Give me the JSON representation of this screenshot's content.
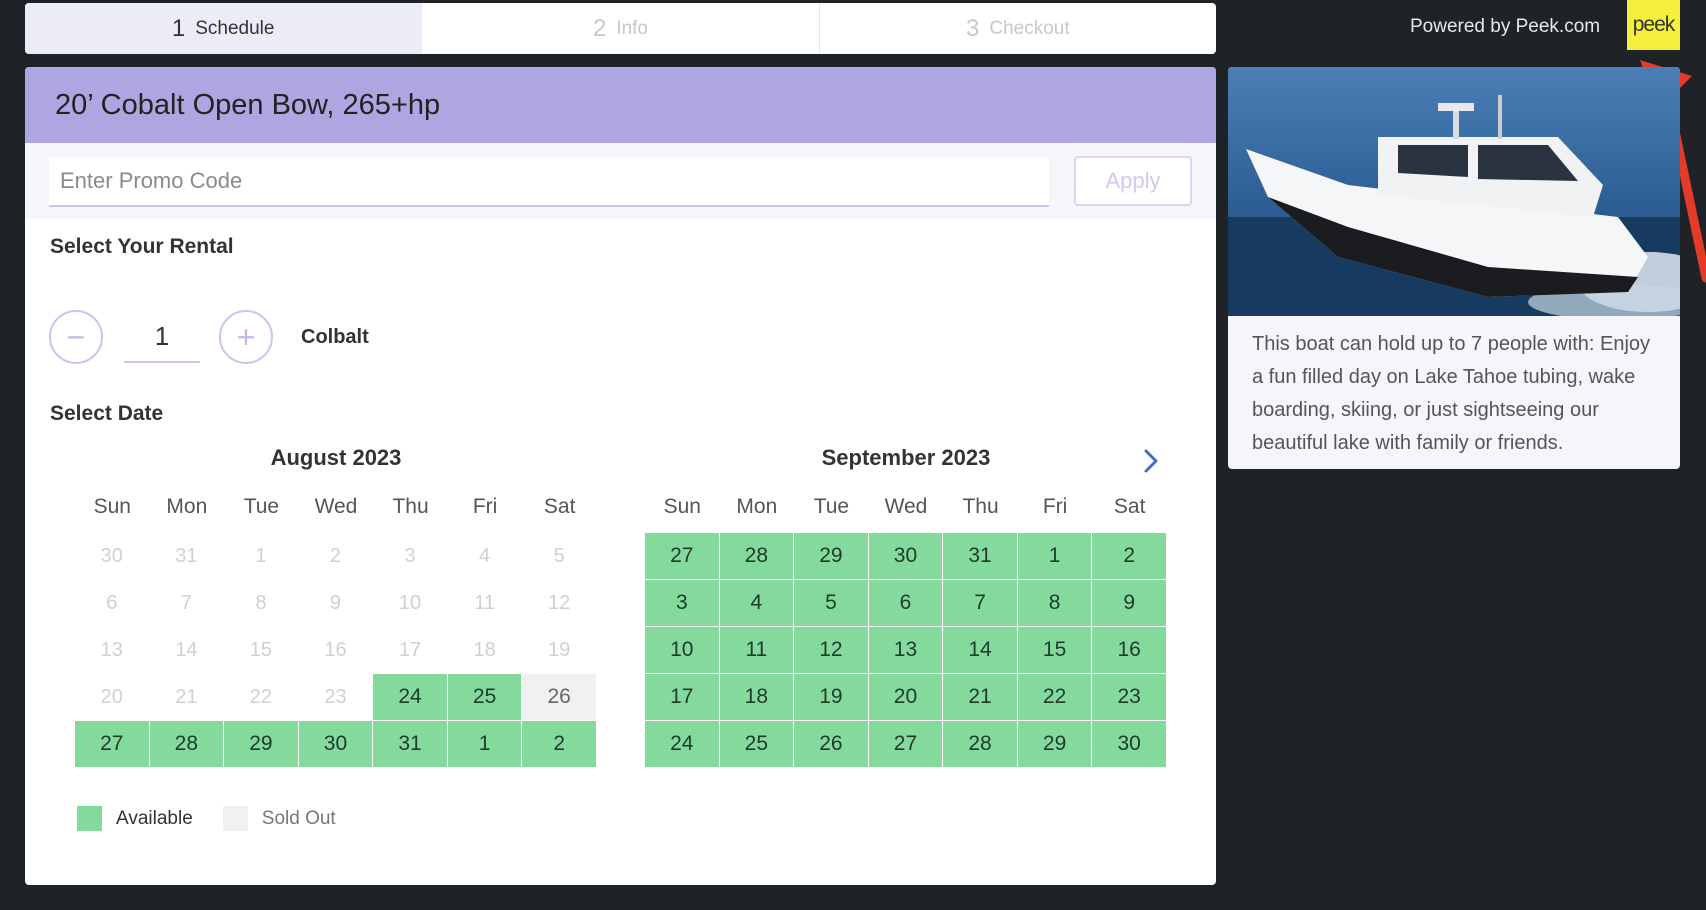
{
  "steps": [
    {
      "num": "1",
      "label": "Schedule"
    },
    {
      "num": "2",
      "label": "Info"
    },
    {
      "num": "3",
      "label": "Checkout"
    }
  ],
  "powered_by": "Powered by Peek.com",
  "logo_text": "peek",
  "product_title": "20’ Cobalt Open Bow, 265+hp",
  "promo": {
    "placeholder": "Enter Promo Code",
    "value": "",
    "apply_label": "Apply"
  },
  "rental": {
    "section_title": "Select Your Rental",
    "quantity": "1",
    "name": "Colbalt",
    "minus_symbol": "−",
    "plus_symbol": "+"
  },
  "date": {
    "section_title": "Select Date"
  },
  "days_of_week": [
    "Sun",
    "Mon",
    "Tue",
    "Wed",
    "Thu",
    "Fri",
    "Sat"
  ],
  "calendars": [
    {
      "month": "August 2023",
      "days": [
        {
          "d": "30",
          "s": "off"
        },
        {
          "d": "31",
          "s": "off"
        },
        {
          "d": "1",
          "s": "off"
        },
        {
          "d": "2",
          "s": "off"
        },
        {
          "d": "3",
          "s": "off"
        },
        {
          "d": "4",
          "s": "off"
        },
        {
          "d": "5",
          "s": "off"
        },
        {
          "d": "6",
          "s": "off"
        },
        {
          "d": "7",
          "s": "off"
        },
        {
          "d": "8",
          "s": "off"
        },
        {
          "d": "9",
          "s": "off"
        },
        {
          "d": "10",
          "s": "off"
        },
        {
          "d": "11",
          "s": "off"
        },
        {
          "d": "12",
          "s": "off"
        },
        {
          "d": "13",
          "s": "off"
        },
        {
          "d": "14",
          "s": "off"
        },
        {
          "d": "15",
          "s": "off"
        },
        {
          "d": "16",
          "s": "off"
        },
        {
          "d": "17",
          "s": "off"
        },
        {
          "d": "18",
          "s": "off"
        },
        {
          "d": "19",
          "s": "off"
        },
        {
          "d": "20",
          "s": "off"
        },
        {
          "d": "21",
          "s": "off"
        },
        {
          "d": "22",
          "s": "off"
        },
        {
          "d": "23",
          "s": "off"
        },
        {
          "d": "24",
          "s": "available"
        },
        {
          "d": "25",
          "s": "available"
        },
        {
          "d": "26",
          "s": "soldout"
        },
        {
          "d": "27",
          "s": "available"
        },
        {
          "d": "28",
          "s": "available"
        },
        {
          "d": "29",
          "s": "available"
        },
        {
          "d": "30",
          "s": "available"
        },
        {
          "d": "31",
          "s": "available"
        },
        {
          "d": "1",
          "s": "available"
        },
        {
          "d": "2",
          "s": "available"
        }
      ]
    },
    {
      "month": "September 2023",
      "days": [
        {
          "d": "27",
          "s": "available"
        },
        {
          "d": "28",
          "s": "available"
        },
        {
          "d": "29",
          "s": "available"
        },
        {
          "d": "30",
          "s": "available"
        },
        {
          "d": "31",
          "s": "available"
        },
        {
          "d": "1",
          "s": "available"
        },
        {
          "d": "2",
          "s": "available"
        },
        {
          "d": "3",
          "s": "available"
        },
        {
          "d": "4",
          "s": "available"
        },
        {
          "d": "5",
          "s": "available"
        },
        {
          "d": "6",
          "s": "available"
        },
        {
          "d": "7",
          "s": "available"
        },
        {
          "d": "8",
          "s": "available"
        },
        {
          "d": "9",
          "s": "available"
        },
        {
          "d": "10",
          "s": "available"
        },
        {
          "d": "11",
          "s": "available"
        },
        {
          "d": "12",
          "s": "available"
        },
        {
          "d": "13",
          "s": "available"
        },
        {
          "d": "14",
          "s": "available"
        },
        {
          "d": "15",
          "s": "available"
        },
        {
          "d": "16",
          "s": "available"
        },
        {
          "d": "17",
          "s": "available"
        },
        {
          "d": "18",
          "s": "available"
        },
        {
          "d": "19",
          "s": "available"
        },
        {
          "d": "20",
          "s": "available"
        },
        {
          "d": "21",
          "s": "available"
        },
        {
          "d": "22",
          "s": "available"
        },
        {
          "d": "23",
          "s": "available"
        },
        {
          "d": "24",
          "s": "available"
        },
        {
          "d": "25",
          "s": "available"
        },
        {
          "d": "26",
          "s": "available"
        },
        {
          "d": "27",
          "s": "available"
        },
        {
          "d": "28",
          "s": "available"
        },
        {
          "d": "29",
          "s": "available"
        },
        {
          "d": "30",
          "s": "available"
        }
      ]
    }
  ],
  "legend": {
    "available": "Available",
    "sold_out": "Sold Out"
  },
  "description": "This boat can hold up to 7 people with: Enjoy a fun filled day on Lake Tahoe tubing, wake boarding, skiing, or just sightseeing our beautiful lake with family or friends.",
  "colors": {
    "header": "#ada6e0",
    "available": "#84da9c",
    "sold_out": "#f1f1f1",
    "logo_bg": "#f3ef3a",
    "background": "#1f2227",
    "annotation_arrow": "#e23b2a"
  },
  "icons": [
    "minus-icon",
    "plus-icon",
    "chevron-right-icon",
    "arrow-annotation"
  ]
}
